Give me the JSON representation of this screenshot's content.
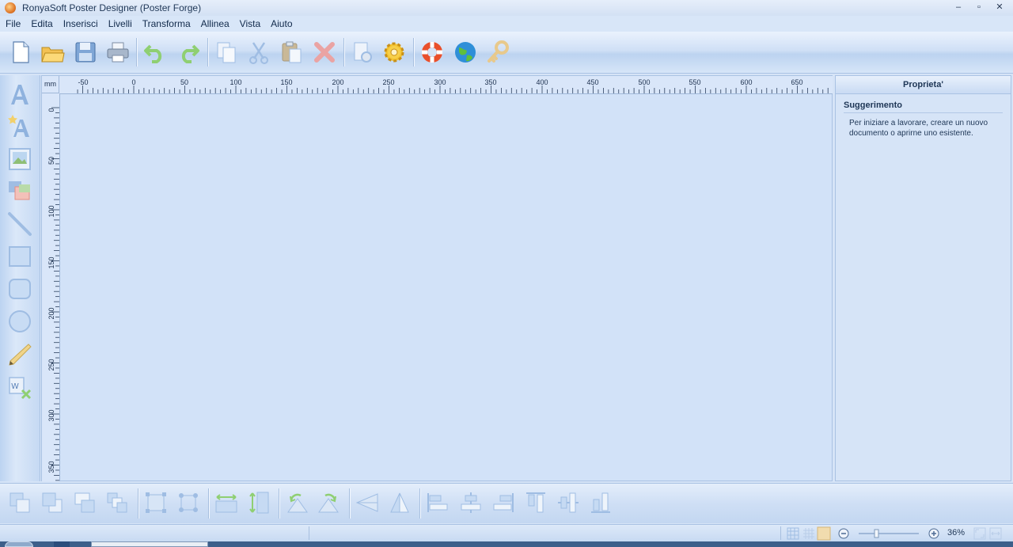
{
  "window": {
    "title": "RonyaSoft Poster Designer (Poster Forge)",
    "minimize": "–",
    "restore": "▫",
    "close": "✕"
  },
  "menu": {
    "items": [
      "File",
      "Edita",
      "Inserisci",
      "Livelli",
      "Transforma",
      "Allinea",
      "Vista",
      "Aiuto"
    ]
  },
  "toolbar": {
    "icons": [
      "new-document-icon",
      "open-folder-icon",
      "save-icon",
      "print-icon",
      "undo-icon",
      "redo-icon",
      "copy-icon",
      "cut-icon",
      "paste-icon",
      "delete-icon",
      "page-settings-icon",
      "settings-gear-icon",
      "help-lifebuoy-icon",
      "web-globe-icon",
      "key-icon"
    ]
  },
  "left_tools": {
    "icons": [
      "text-tool-icon",
      "art-text-tool-icon",
      "image-tool-icon",
      "clipart-tool-icon",
      "line-tool-icon",
      "rectangle-tool-icon",
      "rounded-rectangle-tool-icon",
      "ellipse-tool-icon",
      "pencil-tool-icon",
      "word-object-tool-icon"
    ]
  },
  "ruler": {
    "unit": "mm",
    "top_labels": [
      "-50",
      "0",
      "50",
      "100",
      "150",
      "200",
      "250",
      "300",
      "350",
      "400",
      "450",
      "500",
      "550",
      "600",
      "650"
    ],
    "left_labels": [
      "0",
      "50",
      "100",
      "150",
      "200",
      "250",
      "300",
      "350"
    ]
  },
  "properties": {
    "title": "Proprieta'",
    "section": "Suggerimento",
    "hint": "Per iniziare a lavorare, creare un nuovo documento o aprirne uno esistente."
  },
  "bottom_tools": {
    "icons": [
      "bring-to-front-icon",
      "send-to-back-icon",
      "bring-forward-icon",
      "send-backward-icon",
      "group-icon",
      "ungroup-icon",
      "same-width-icon",
      "same-height-icon",
      "rotate-left-icon",
      "rotate-right-icon",
      "flip-horizontal-icon",
      "flip-vertical-icon",
      "align-left-icon",
      "align-center-icon",
      "align-right-icon",
      "align-top-icon",
      "align-middle-icon",
      "align-bottom-icon"
    ]
  },
  "status": {
    "zoom": "36%"
  },
  "colors": {
    "accent": "#d6e4f7",
    "toolbar": "#bcd3f0",
    "icon_muted": "#9fbde3"
  }
}
